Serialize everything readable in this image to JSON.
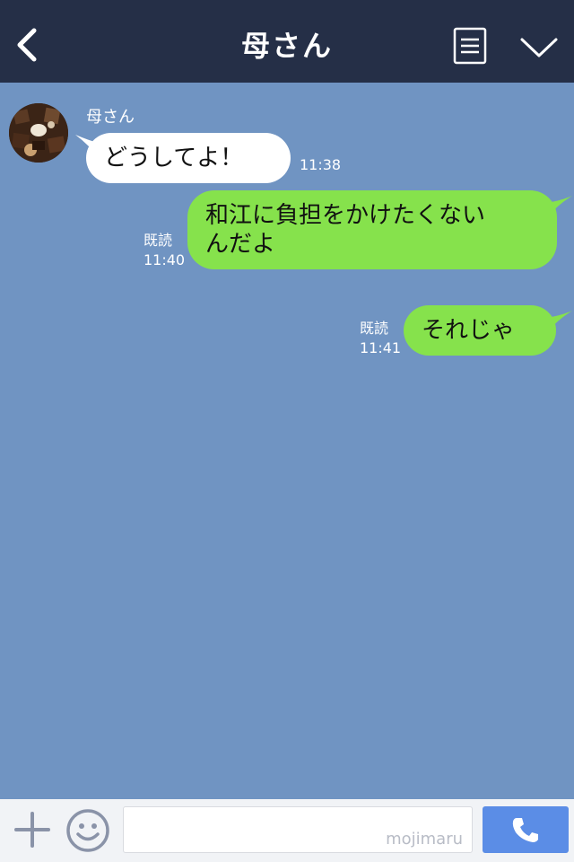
{
  "header": {
    "title": "母さん"
  },
  "chat": {
    "sender_name": "母さん",
    "messages": [
      {
        "direction": "in",
        "text": "どうしてよ！",
        "time": "11:38"
      },
      {
        "direction": "out",
        "lines": [
          "和江に負担をかけたくない",
          "んだよ"
        ],
        "read": "既読",
        "time": "11:40"
      },
      {
        "direction": "out",
        "text": "それじゃ",
        "read": "既読",
        "time": "11:41"
      }
    ]
  },
  "footer": {
    "input_placeholder": "mojimaru"
  },
  "colors": {
    "header_bg": "#252f47",
    "chat_bg": "#7094c2",
    "outgoing_bubble": "#86e24c",
    "incoming_bubble": "#ffffff",
    "call_button": "#5b8de6"
  }
}
